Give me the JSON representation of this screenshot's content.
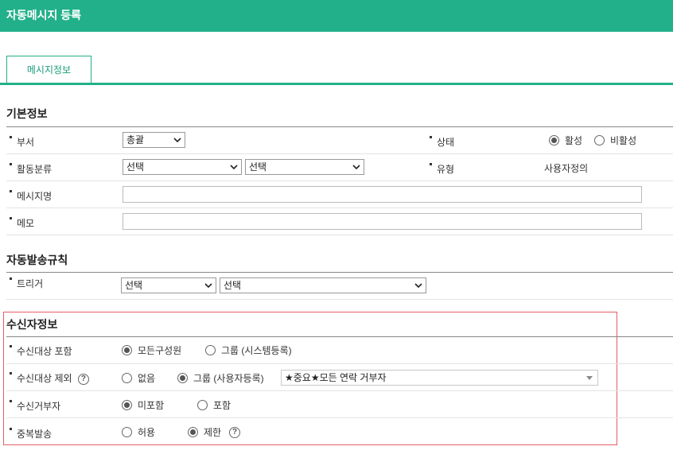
{
  "title": "자동메시지 등록",
  "tab": {
    "label": "메시지정보"
  },
  "basic": {
    "title": "기본정보",
    "department": {
      "label": "부서",
      "value": "총괄"
    },
    "status": {
      "label": "상태",
      "options": [
        "활성",
        "비활성"
      ],
      "selected": "활성"
    },
    "activity_category": {
      "label": "활동분류",
      "value1": "선택",
      "value2": "선택"
    },
    "type": {
      "label": "유형",
      "value": "사용자정의"
    },
    "message_name": {
      "label": "메시지명",
      "value": ""
    },
    "memo": {
      "label": "메모",
      "value": ""
    }
  },
  "auto_rule": {
    "title": "자동발송규칙",
    "trigger": {
      "label": "트리거",
      "value1": "선택",
      "value2": "선택"
    }
  },
  "recipient": {
    "title": "수신자정보",
    "include": {
      "label": "수신대상 포함",
      "options": [
        "모든구성원",
        "그룹 (시스템등록)"
      ],
      "selected": "모든구성원"
    },
    "exclude": {
      "label": "수신대상 제외",
      "options": [
        "없음",
        "그룹 (사용자등록)"
      ],
      "selected": "그룹 (사용자등록)",
      "group_value": "★중요★모든 연락 거부자"
    },
    "refusers": {
      "label": "수신거부자",
      "options": [
        "미포함",
        "포함"
      ],
      "selected": "미포함"
    },
    "duplicate": {
      "label": "중복발송",
      "options": [
        "허용",
        "제한"
      ],
      "selected": "제한"
    }
  },
  "help_glyph": "?",
  "colors": {
    "brand": "#22b08a",
    "highlight_border": "#e65c66"
  }
}
